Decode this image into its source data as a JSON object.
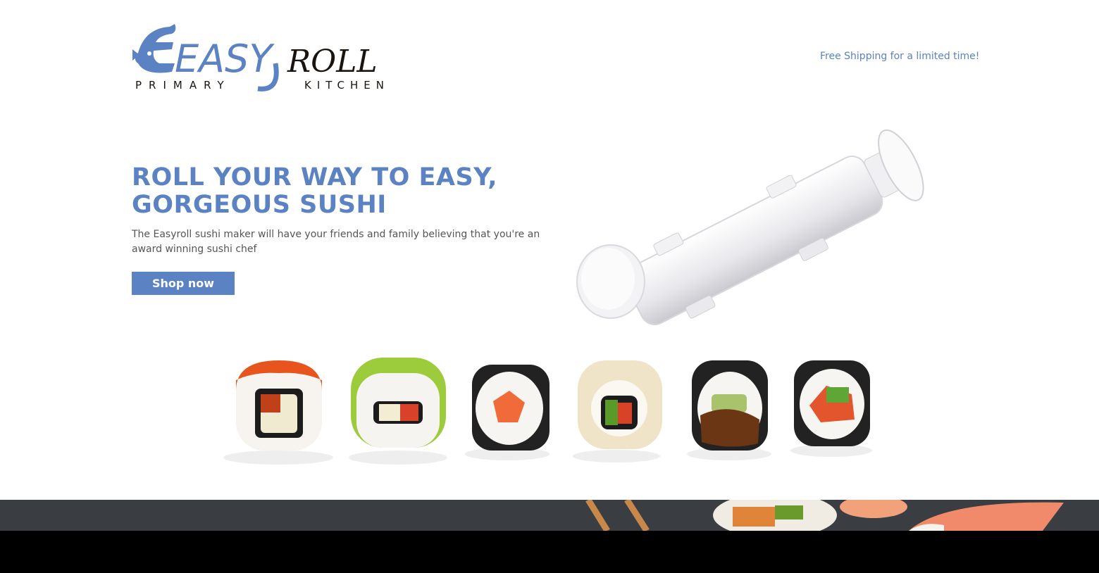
{
  "brand": {
    "logo_word_easy": "EASY",
    "logo_word_roll": "ROLL",
    "tagline_left": "PRIMARY",
    "tagline_right": "KITCHEN"
  },
  "header": {
    "shipping_text": "Free Shipping for a limited time!"
  },
  "hero": {
    "title": "ROLL YOUR WAY TO EASY, GORGEOUS SUSHI",
    "description": "The Easyroll sushi maker will have your friends and family believing that you're an award winning sushi chef",
    "cta_label": "Shop now"
  },
  "colors": {
    "accent": "#5b82c2",
    "text": "#555555",
    "banner": "#3a3d42"
  },
  "images": {
    "product": "sushi-bazooka-roller-image",
    "rolls": "sushi-rolls-row-image",
    "banner": "sushi-chopsticks-banner-image"
  }
}
